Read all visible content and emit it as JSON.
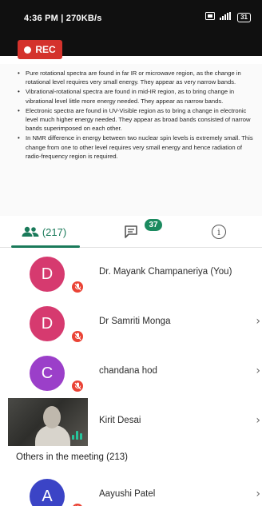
{
  "status_bar": {
    "time_speed": "4:36 PM | 270KB/s",
    "battery": "31"
  },
  "recording": {
    "label": "REC"
  },
  "shared_content": {
    "bullets": [
      "Pure rotational spectra are found in far IR or microwave region, as the change in rotational level requires very small energy. They appear as very narrow bands.",
      "Vibrational-rotational spectra are found in mid-IR region, as to bring change in vibrational level little more energy needed. They appear as narrow bands.",
      "Electronic spectra are found in UV-Visible region as to bring a change in electronic level much higher energy needed. They appear as broad bands consisted of narrow bands superimposed on each other.",
      "In NMR difference in energy between two nuclear spin levels is extremely small. This change from one to other level requires very small energy and hence radiation of radio-frequency region is required."
    ]
  },
  "tabs": {
    "people_count": "(217)",
    "chat_unread": "37"
  },
  "participants": [
    {
      "initial": "D",
      "name": "Dr. Mayank Champaneriya (You)",
      "color": "#d63a6f"
    },
    {
      "initial": "D",
      "name": "Dr Samriti Monga",
      "color": "#d63a6f"
    },
    {
      "initial": "C",
      "name": "chandana hod",
      "color": "#9b3fc9"
    },
    {
      "initial": "",
      "name": "Kirit Desai",
      "color": "#3a3a3a"
    }
  ],
  "others": {
    "header": "Others in the meeting (213)",
    "first": {
      "initial": "A",
      "name": "Aayushi Patel",
      "color": "#3b44c6"
    }
  }
}
